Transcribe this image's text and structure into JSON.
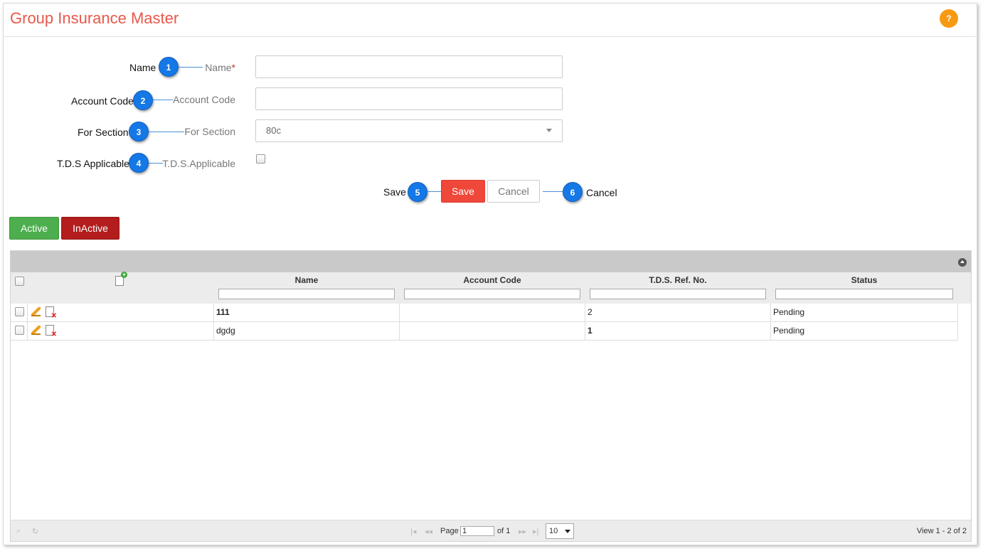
{
  "header": {
    "title": "Group Insurance Master",
    "help_label": "?"
  },
  "annotations": [
    {
      "label": "Name",
      "number": "1"
    },
    {
      "label": "Account Code",
      "number": "2"
    },
    {
      "label": "For Section",
      "number": "3"
    },
    {
      "label": "T.D.S Applicable",
      "number": "4"
    },
    {
      "label": "Save",
      "number": "5"
    },
    {
      "label": "Cancel",
      "number": "6"
    }
  ],
  "form": {
    "name_label": "Name",
    "name_required": "*",
    "name_value": "",
    "account_code_label": "Account Code",
    "account_code_value": "",
    "for_section_label": "For Section",
    "for_section_value": "80c",
    "tds_label": "T.D.S.Applicable",
    "tds_checked": false,
    "save_label": "Save",
    "cancel_label": "Cancel"
  },
  "filters": {
    "active_label": "Active",
    "inactive_label": "InActive"
  },
  "grid": {
    "columns": [
      "Name",
      "Account Code",
      "T.D.S. Ref. No.",
      "Status"
    ],
    "rows": [
      {
        "name": "111",
        "account_code": "",
        "tds_ref": "2",
        "status": "Pending"
      },
      {
        "name": "dgdg",
        "account_code": "",
        "tds_ref": "1",
        "status": "Pending"
      }
    ]
  },
  "pager": {
    "page_label": "Page",
    "page_value": "1",
    "of_label": "of 1",
    "page_size": "10",
    "view_info": "View 1 - 2 of 2"
  },
  "colors": {
    "title": "#e8584a",
    "help": "#f79a12",
    "callout": "#1478e6",
    "save": "#ef473a",
    "active": "#4cae4c",
    "inactive": "#b31d1d"
  }
}
